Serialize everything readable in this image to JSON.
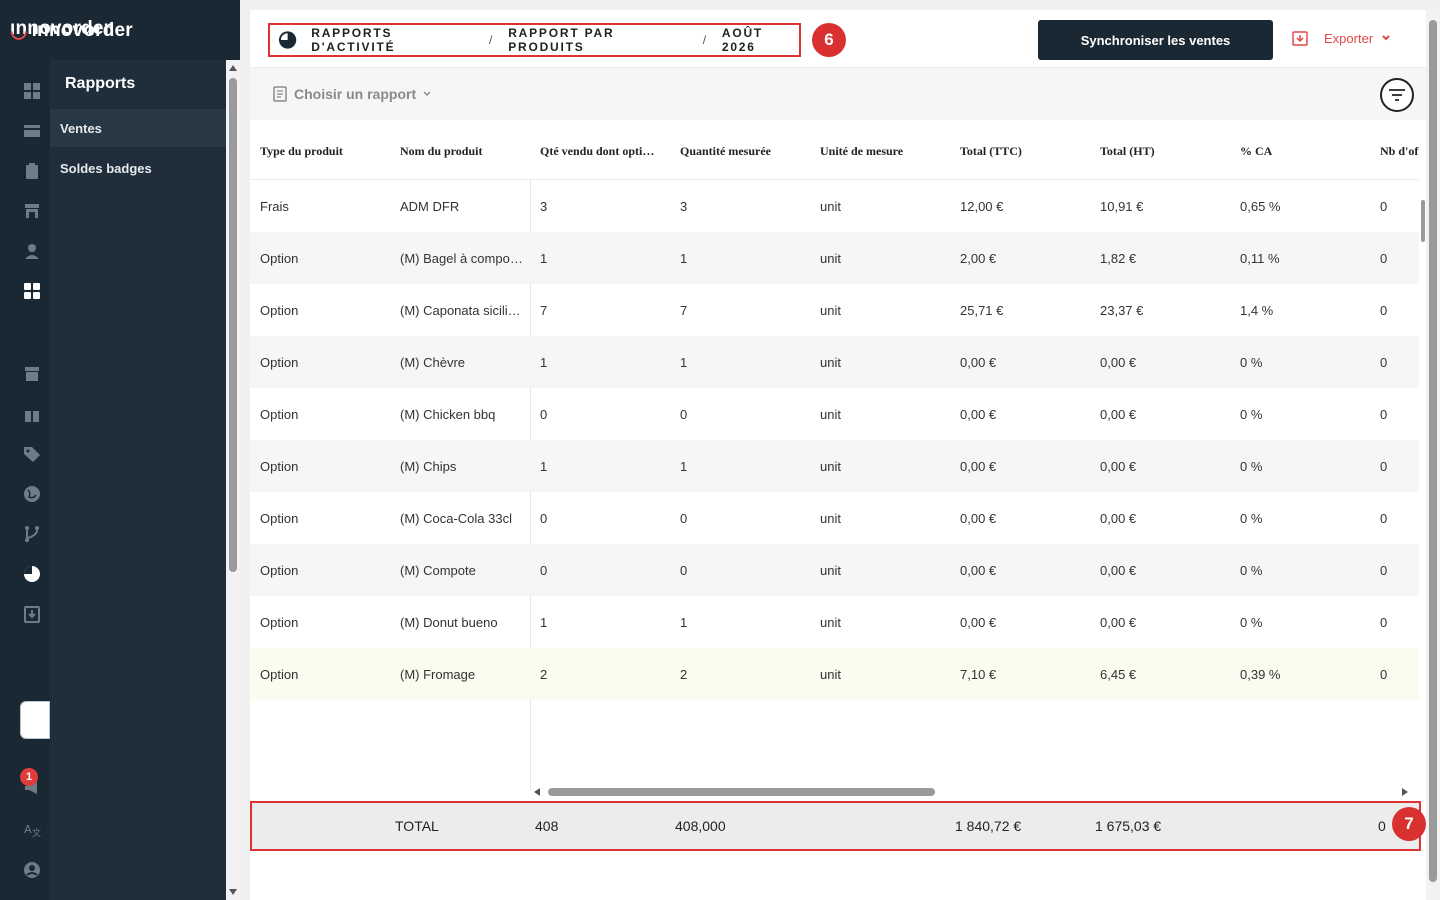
{
  "app": {
    "logo_text": "ınnovorder",
    "notification_count": "1"
  },
  "subnav": {
    "title": "Rapports",
    "items": [
      {
        "label": "Ventes",
        "active": true
      },
      {
        "label": "Soldes badges",
        "active": false
      }
    ]
  },
  "header": {
    "breadcrumb": [
      "RAPPORTS D'ACTIVITÉ",
      "RAPPORT PAR PRODUITS",
      "AOÛT 2026"
    ],
    "separator": "/",
    "step_badge_breadcrumb": "6",
    "sync_button": "Synchroniser les ventes",
    "export_label": "Exporter"
  },
  "toolbar": {
    "report_select": "Choisir un rapport"
  },
  "table": {
    "columns": [
      "Type du produit",
      "Nom du produit",
      "Qté vendu dont options",
      "Quantité mesurée",
      "Unité de mesure",
      "Total (TTC)",
      "Total (HT)",
      "% CA",
      "Nb d'offerts"
    ],
    "rows": [
      [
        "Frais",
        "ADM DFR",
        "3",
        "3",
        "unit",
        "12,00 €",
        "10,91 €",
        "0,65 %",
        "0"
      ],
      [
        "Option",
        "(M) Bagel à composer",
        "1",
        "1",
        "unit",
        "2,00 €",
        "1,82 €",
        "0,11 %",
        "0"
      ],
      [
        "Option",
        "(M) Caponata sicilienne",
        "7",
        "7",
        "unit",
        "25,71 €",
        "23,37 €",
        "1,4 %",
        "0"
      ],
      [
        "Option",
        "(M) Chèvre",
        "1",
        "1",
        "unit",
        "0,00 €",
        "0,00 €",
        "0 %",
        "0"
      ],
      [
        "Option",
        "(M) Chicken bbq",
        "0",
        "0",
        "unit",
        "0,00 €",
        "0,00 €",
        "0 %",
        "0"
      ],
      [
        "Option",
        "(M) Chips",
        "1",
        "1",
        "unit",
        "0,00 €",
        "0,00 €",
        "0 %",
        "0"
      ],
      [
        "Option",
        "(M) Coca-Cola 33cl",
        "0",
        "0",
        "unit",
        "0,00 €",
        "0,00 €",
        "0 %",
        "0"
      ],
      [
        "Option",
        "(M) Compote",
        "0",
        "0",
        "unit",
        "0,00 €",
        "0,00 €",
        "0 %",
        "0"
      ],
      [
        "Option",
        "(M) Donut bueno",
        "1",
        "1",
        "unit",
        "0,00 €",
        "0,00 €",
        "0 %",
        "0"
      ],
      [
        "Option",
        "(M) Fromage",
        "2",
        "2",
        "unit",
        "7,10 €",
        "6,45 €",
        "0,39 %",
        "0"
      ]
    ]
  },
  "totals": {
    "label": "TOTAL",
    "qty": "408",
    "measured": "408,000",
    "ttc": "1 840,72 €",
    "ht": "1 675,03 €",
    "offered": "0",
    "step_badge": "7"
  },
  "colors": {
    "accent_red": "#d8312f",
    "dark_navy": "#1a2833",
    "export_red": "#e04a4a"
  }
}
